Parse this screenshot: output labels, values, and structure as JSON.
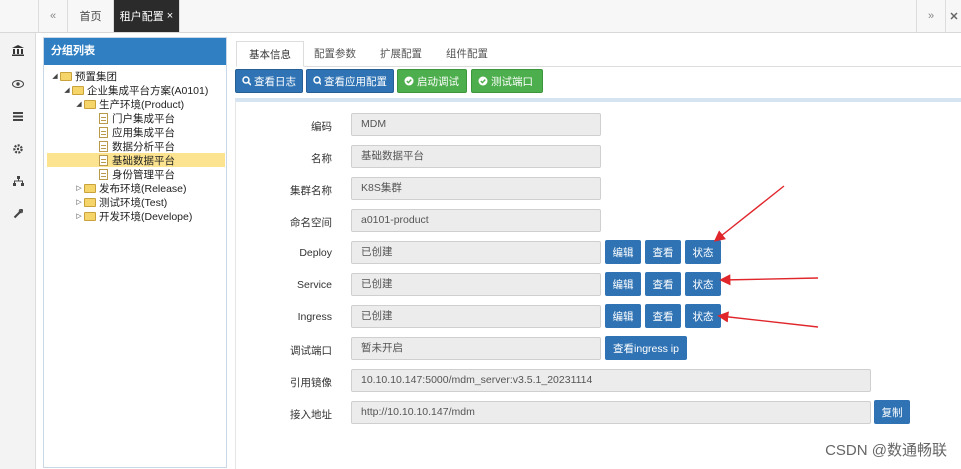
{
  "topbar": {
    "tabs": [
      {
        "label": "首页"
      },
      {
        "label": "租户配置",
        "close": "×"
      }
    ],
    "nav_left_glyph": "«",
    "nav_right_glyph": "»"
  },
  "rail_icons": [
    "id-card-icon",
    "bank-icon",
    "eye-icon",
    "list-icon",
    "gear-icon",
    "sitemap-icon",
    "wrench-icon"
  ],
  "group_panel": {
    "title": "分组列表",
    "tree": [
      {
        "label": "预置集团",
        "type": "folder",
        "expanded": true
      },
      {
        "label": "企业集成平台方案(A0101)",
        "type": "folder",
        "expanded": true
      },
      {
        "label": "生产环境(Product)",
        "type": "folder",
        "expanded": true
      },
      {
        "label": "门户集成平台",
        "type": "file"
      },
      {
        "label": "应用集成平台",
        "type": "file"
      },
      {
        "label": "数据分析平台",
        "type": "file"
      },
      {
        "label": "基础数据平台",
        "type": "file",
        "selected": true
      },
      {
        "label": "身份管理平台",
        "type": "file"
      },
      {
        "label": "发布环境(Release)",
        "type": "folder",
        "expanded": false
      },
      {
        "label": "测试环境(Test)",
        "type": "folder",
        "expanded": false
      },
      {
        "label": "开发环境(Develope)",
        "type": "folder",
        "expanded": false
      }
    ]
  },
  "subtabs": [
    "基本信息",
    "配置参数",
    "扩展配置",
    "组件配置"
  ],
  "toolbar": {
    "view_log": "查看日志",
    "view_app_config": "查看应用配置",
    "start_debug": "启动调试",
    "test_port": "测试端口"
  },
  "form": {
    "code": {
      "label": "编码",
      "value": "MDM"
    },
    "name": {
      "label": "名称",
      "value": "基础数据平台"
    },
    "cluster": {
      "label": "集群名称",
      "value": "K8S集群"
    },
    "namespace": {
      "label": "命名空间",
      "value": "a0101-product"
    },
    "deploy": {
      "label": "Deploy",
      "value": "已创建"
    },
    "service": {
      "label": "Service",
      "value": "已创建"
    },
    "ingress": {
      "label": "Ingress",
      "value": "已创建"
    },
    "debug_port": {
      "label": "调试端口",
      "value": "暂未开启"
    },
    "image": {
      "label": "引用镜像",
      "value": "10.10.10.147:5000/mdm_server:v3.5.1_20231114"
    },
    "access_url": {
      "label": "接入地址",
      "value": "http://10.10.10.147/mdm"
    }
  },
  "actions": {
    "edit": "编辑",
    "view": "查看",
    "status": "状态",
    "view_ingress_ip": "查看ingress ip",
    "copy": "复制"
  },
  "watermark": "CSDN @数通畅联",
  "colors": {
    "primary_blue": "#2f73b4",
    "header_blue": "#2f7fc2",
    "green": "#4cae4c",
    "selected_row": "#fbe38f",
    "arrow_red": "#e0262b",
    "active_tab": "#2b2b2b"
  }
}
